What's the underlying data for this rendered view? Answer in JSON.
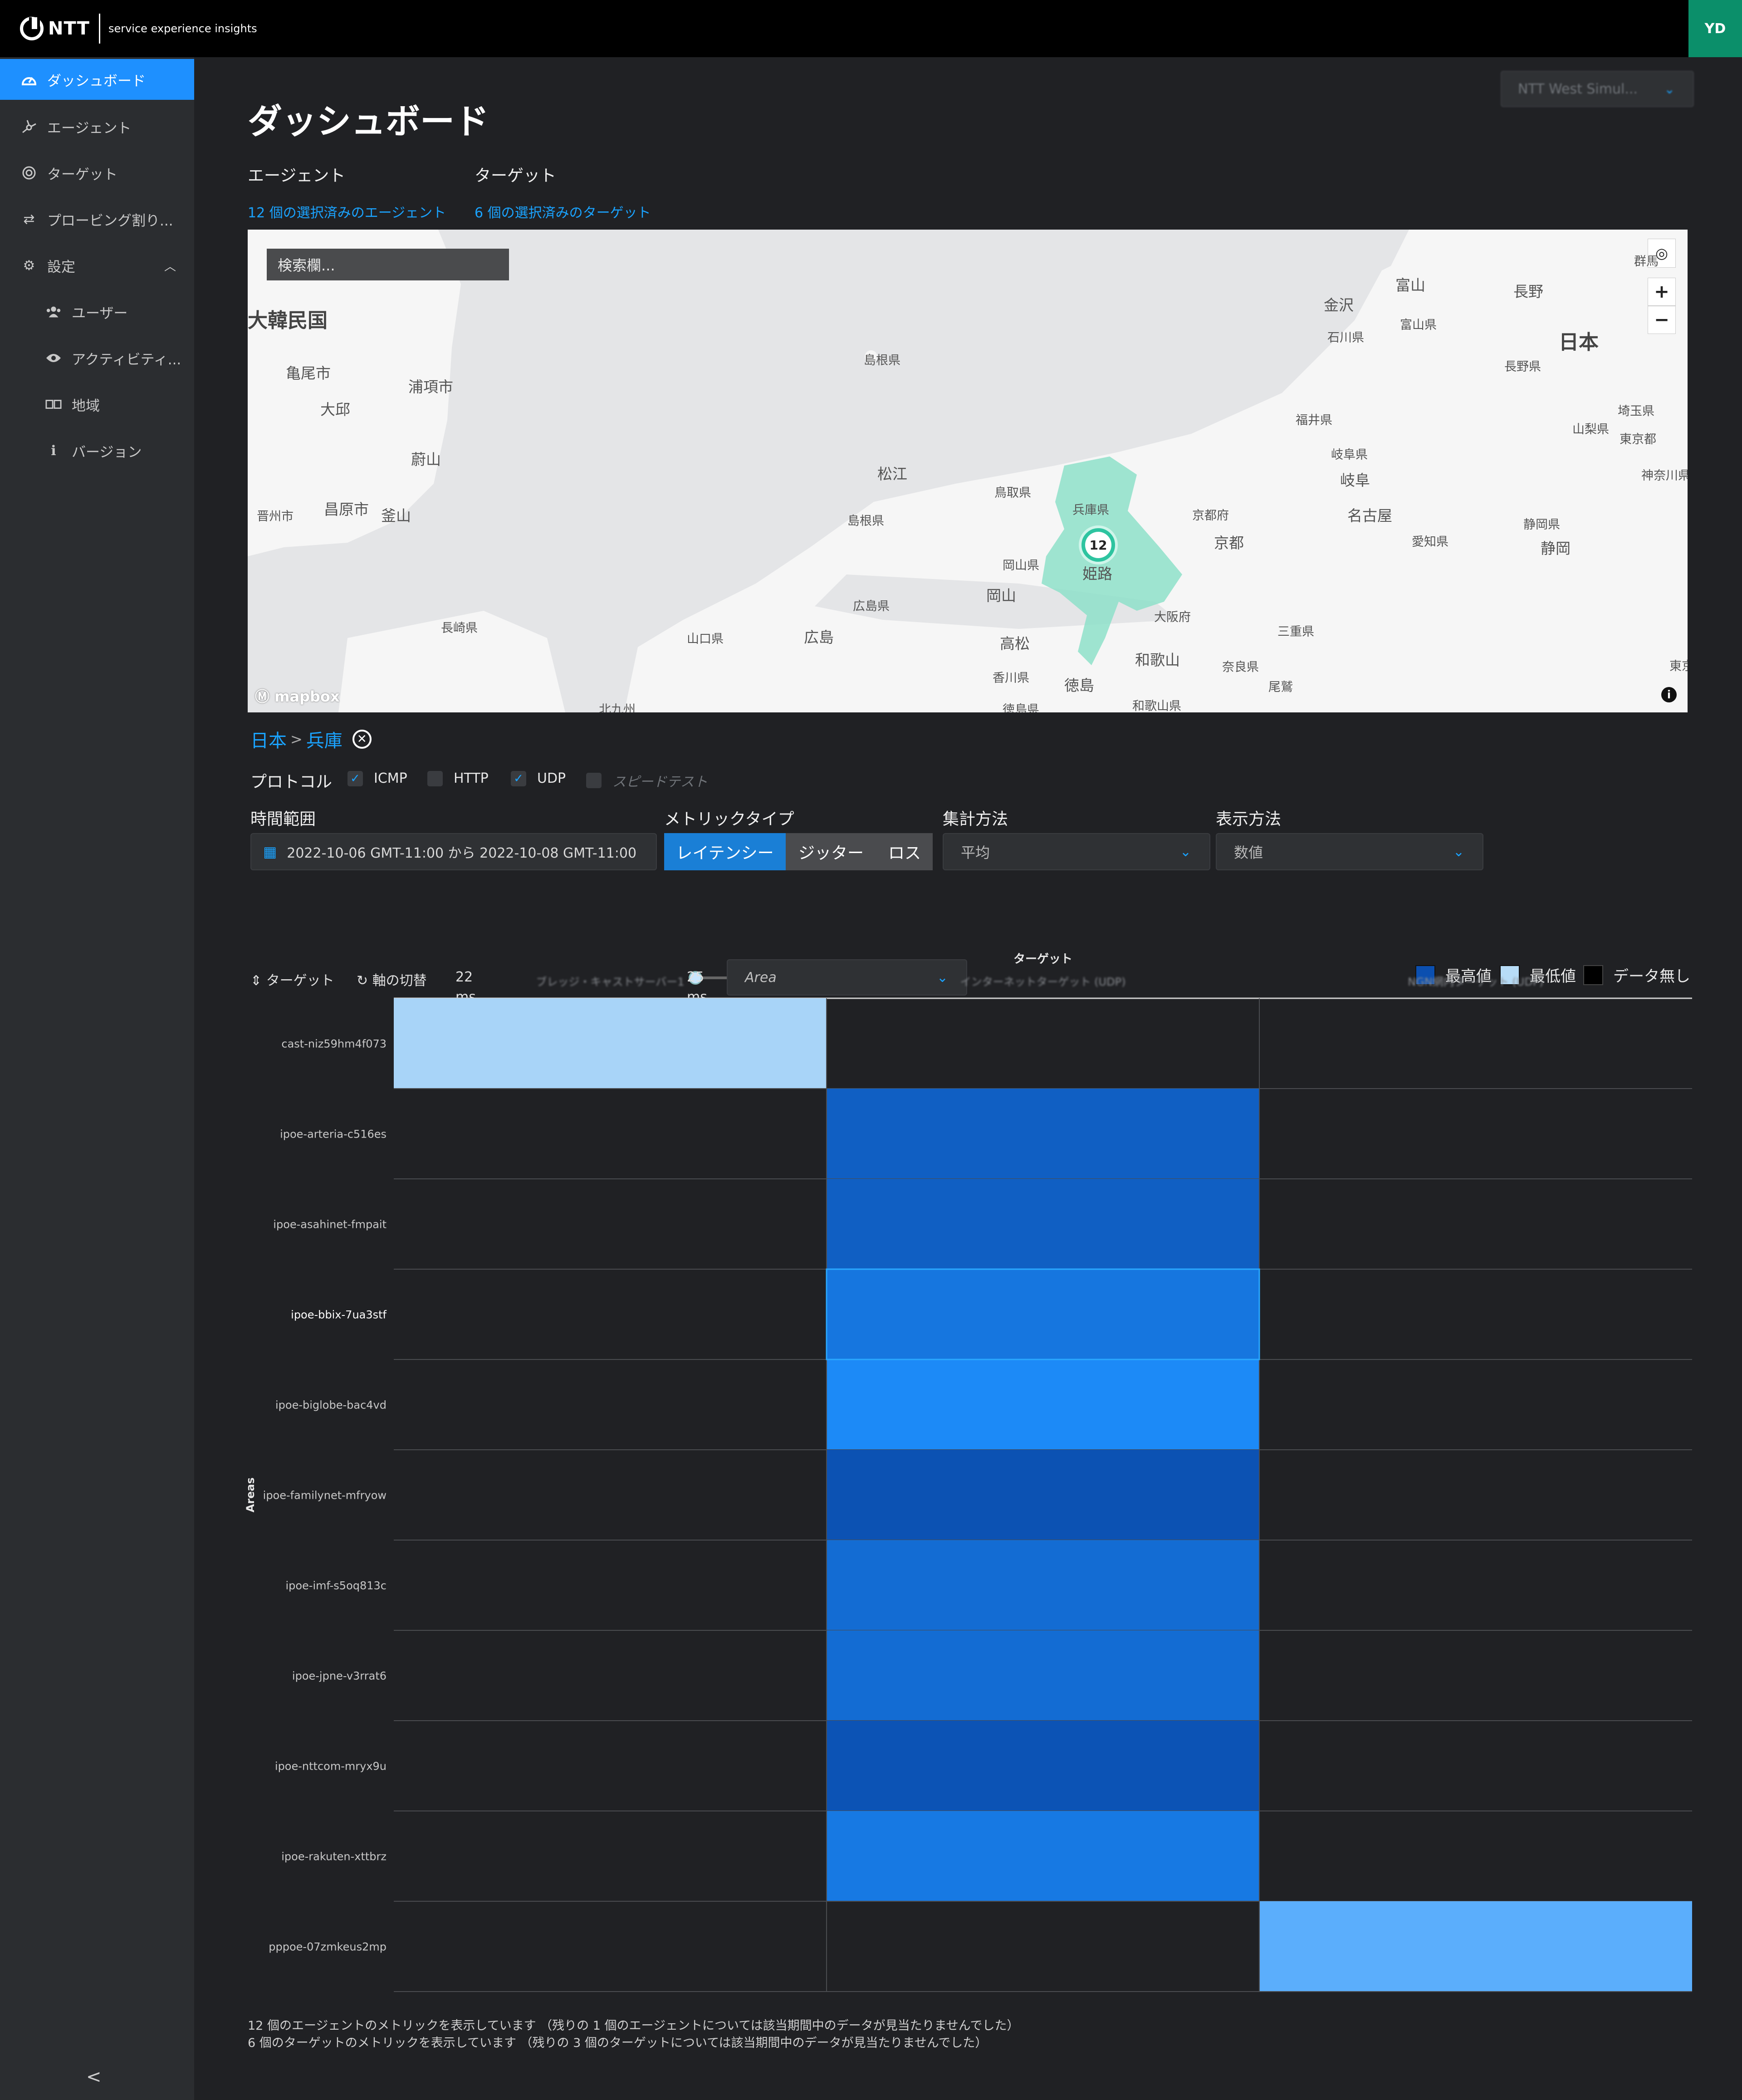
{
  "topbar": {
    "brand": "NTT",
    "product": "service experience insights",
    "user_initials": "YD"
  },
  "sidebar": {
    "items": [
      {
        "label": "ダッシュボード",
        "icon": "dashboard-icon",
        "active": true
      },
      {
        "label": "エージェント",
        "icon": "agent-icon"
      },
      {
        "label": "ターゲット",
        "icon": "target-icon"
      },
      {
        "label": "プロービング割り...",
        "icon": "swap-icon"
      },
      {
        "label": "設定",
        "icon": "gear-icon"
      },
      {
        "label": "ユーザー",
        "icon": "users-icon"
      },
      {
        "label": "アクティビティ...",
        "icon": "eye-icon"
      },
      {
        "label": "地域",
        "icon": "map-icon"
      },
      {
        "label": "バージョン",
        "icon": "info-icon"
      }
    ],
    "collapse_label": "<"
  },
  "header": {
    "title": "ダッシュボード",
    "org_select": "NTT West Simul..."
  },
  "filters": {
    "agents_label": "エージェント",
    "agents_link": "12 個の選択済みのエージェント",
    "targets_label": "ターゲット",
    "targets_link": "6 個の選択済みのターゲット"
  },
  "map": {
    "search_placeholder": "検索欄...",
    "cluster_count": "12",
    "attribution": "mapbox",
    "labels": {
      "korea": "大韓民国",
      "japan": "日本",
      "kyoto": "京都",
      "nagoya": "名古屋",
      "himeji": "姫路",
      "okayama": "岡山",
      "hiroshima": "広島",
      "takamatsu": "高松",
      "tokushima": "徳島",
      "wakayama": "和歌山",
      "matsue": "松江",
      "kanazawa": "金沢",
      "toyama": "富山",
      "nagano": "長野",
      "shizuoka": "静岡",
      "daegu": "大邱",
      "busan": "釜山",
      "ulsan": "蔚山",
      "pohang": "浦項市",
      "gumi": "亀尾市",
      "changwon": "昌原市",
      "jinju": "晋州市",
      "hyogo": "兵庫県",
      "tottori": "鳥取県",
      "shimane": "島根県",
      "okayama_pref": "岡山県",
      "hiroshima_pref": "広島県",
      "yamaguchi": "山口県",
      "nagasaki": "長崎県",
      "kagawa": "香川県",
      "tokushima_pref": "徳島県",
      "wakayama_pref": "和歌山県",
      "osaka": "大阪府",
      "kyoto_pref": "京都府",
      "nara": "奈良県",
      "mie": "三重県",
      "aichi": "愛知県",
      "shizuoka_pref": "静岡県",
      "gifu_pref": "岐阜県",
      "gifu": "岐阜",
      "fukui": "福井県",
      "ishikawa": "石川県",
      "toyama_pref": "富山県",
      "nagano_pref": "長野県",
      "yamanashi": "山梨県",
      "saitama": "埼玉県",
      "tokyo": "東京都",
      "kanagawa": "神奈川県",
      "gunma": "群馬",
      "kitakyushu": "北九州",
      "oki": "島根県",
      "owase": "尾鷲",
      "east": "東京"
    }
  },
  "breadcrumb": {
    "country": "日本",
    "separator": ">",
    "region": "兵庫"
  },
  "protocols": {
    "label": "プロトコル",
    "options": [
      {
        "label": "ICMP",
        "checked": true
      },
      {
        "label": "HTTP",
        "checked": false
      },
      {
        "label": "UDP",
        "checked": true
      },
      {
        "label": "スピードテスト",
        "checked": false,
        "disabled": true
      }
    ]
  },
  "controls": {
    "time_range_label": "時間範囲",
    "time_range_value": "2022-10-06 GMT-11:00 から 2022-10-08 GMT-11:00",
    "metric_type_label": "メトリックタイプ",
    "metric_types": [
      "レイテンシー",
      "ジッター",
      "ロス"
    ],
    "metric_selected": "レイテンシー",
    "aggregation_label": "集計方法",
    "aggregation_value": "平均",
    "display_label": "表示方法",
    "display_value": "数値"
  },
  "chart_controls": {
    "sort_label": "ターゲット",
    "swap_label": "軸の切替",
    "range_min": "22",
    "range_max": "25",
    "unit": "ms",
    "slider_value": 0,
    "group_by": "Area",
    "legend": {
      "max": "最高値",
      "min": "最低値",
      "none": "データ無し"
    }
  },
  "colors": {
    "accent": "#1e90ff",
    "link": "#1aa3ff",
    "heat_min": "#b7dcf7",
    "heat_max": "#0b4fb0",
    "no_data": "#000000",
    "selected_item": "#1e90ff"
  },
  "chart_data": {
    "type": "heatmap",
    "title": "ターゲット",
    "xlabel": "ターゲット",
    "ylabel": "Areas",
    "x": [
      "ブレッジ・キャストサーバー1",
      "インターネットターゲット (UDP)",
      "NGN網内ターゲット (UDP)"
    ],
    "y": [
      "cast-niz59hm4f073",
      "ipoe-arteria-c516es",
      "ipoe-asahinet-fmpait",
      "ipoe-bbix-7ua3stf",
      "ipoe-biglobe-bac4vd",
      "ipoe-familynet-mfryow",
      "ipoe-imf-s5oq813c",
      "ipoe-jpne-v3rrat6",
      "ipoe-nttcom-mryx9u",
      "ipoe-rakuten-xttbrz",
      "pppoe-07zmkeus2mp"
    ],
    "scale": "relative (0 = 最低値, 1 = 最高値)",
    "values": [
      [
        0.05,
        null,
        null
      ],
      [
        null,
        0.88,
        null
      ],
      [
        null,
        0.88,
        null
      ],
      [
        null,
        0.7,
        null
      ],
      [
        null,
        0.55,
        null
      ],
      [
        null,
        0.98,
        null
      ],
      [
        null,
        0.78,
        null
      ],
      [
        null,
        0.78,
        null
      ],
      [
        null,
        0.97,
        null
      ],
      [
        null,
        0.68,
        null
      ],
      [
        null,
        null,
        0.3
      ]
    ],
    "highlighted_row": "ipoe-bbix-7ua3stf"
  },
  "footer": {
    "line1": "12 個のエージェントのメトリックを表示しています （残りの 1 個のエージェントについては該当期間中のデータが見当たりませんでした）",
    "line2": "6 個のターゲットのメトリックを表示しています （残りの 3 個のターゲットについては該当期間中のデータが見当たりませんでした）"
  }
}
